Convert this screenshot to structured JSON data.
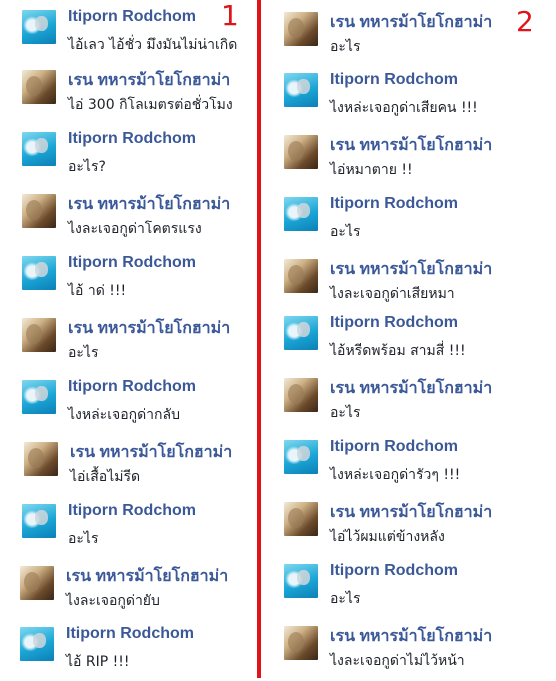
{
  "column_markers": {
    "left": "1",
    "right": "2"
  },
  "left_messages": [
    {
      "sender": "Itiporn Rodchom",
      "avatar": "itiporn",
      "text": "ไอ้เลว ไอ้ชั่ว มึงมันไม่น่าเกิด"
    },
    {
      "sender": "เรน ทหารม้าโยโกฮาม่า",
      "avatar": "ren",
      "text": "ไอ่ 300 กิโลเมตรต่อชั่วโมง"
    },
    {
      "sender": "Itiporn Rodchom",
      "avatar": "itiporn",
      "text": "อะไร?"
    },
    {
      "sender": "เรน ทหารม้าโยโกฮาม่า",
      "avatar": "ren",
      "text": "ไงละเจอกูด่าโคตรแรง"
    },
    {
      "sender": "Itiporn Rodchom",
      "avatar": "itiporn",
      "text": "ไอ้ าด่ !!!"
    },
    {
      "sender": "เรน ทหารม้าโยโกฮาม่า",
      "avatar": "ren",
      "text": "อะไร"
    },
    {
      "sender": "Itiporn Rodchom",
      "avatar": "itiporn",
      "text": "ไงหล่ะเจอกูด่ากลับ"
    },
    {
      "sender": "เรน ทหารม้าโยโกฮาม่า",
      "avatar": "ren",
      "text": "ไอ่เสื้อไม่รีด"
    },
    {
      "sender": "Itiporn Rodchom",
      "avatar": "itiporn",
      "text": "อะไร"
    },
    {
      "sender": "เรน ทหารม้าโยโกฮาม่า",
      "avatar": "ren",
      "text": "ไงละเจอกูด่ายับ"
    },
    {
      "sender": "Itiporn Rodchom",
      "avatar": "itiporn",
      "text": "ไอ้ RIP !!!"
    }
  ],
  "right_messages": [
    {
      "sender": "เรน ทหารม้าโยโกฮาม่า",
      "avatar": "ren",
      "text": "อะไร"
    },
    {
      "sender": "Itiporn Rodchom",
      "avatar": "itiporn",
      "text": "ไงหล่ะเจอกูด่าเสียคน !!!"
    },
    {
      "sender": "เรน ทหารม้าโยโกฮาม่า",
      "avatar": "ren",
      "text": "ไอ่หมาตาย !!"
    },
    {
      "sender": "Itiporn Rodchom",
      "avatar": "itiporn",
      "text": "อะไร"
    },
    {
      "sender": "เรน ทหารม้าโยโกฮาม่า",
      "avatar": "ren",
      "text": "ไงละเจอกูด่าเสียหมา"
    },
    {
      "sender": "Itiporn Rodchom",
      "avatar": "itiporn",
      "text": "ไอ้หรีดพร้อม สามสี่ !!!"
    },
    {
      "sender": "เรน ทหารม้าโยโกฮาม่า",
      "avatar": "ren",
      "text": "อะไร"
    },
    {
      "sender": "Itiporn Rodchom",
      "avatar": "itiporn",
      "text": "ไงหล่ะเจอกูด่ารัวๆ !!!"
    },
    {
      "sender": "เรน ทหารม้าโยโกฮาม่า",
      "avatar": "ren",
      "text": "ไอ่ไว้ผมแต่ข้างหลัง"
    },
    {
      "sender": "Itiporn Rodchom",
      "avatar": "itiporn",
      "text": "อะไร"
    },
    {
      "sender": "เรน ทหารม้าโยโกฮาม่า",
      "avatar": "ren",
      "text": "ไงละเจอกูด่าไม่ไว้หน้า"
    }
  ]
}
